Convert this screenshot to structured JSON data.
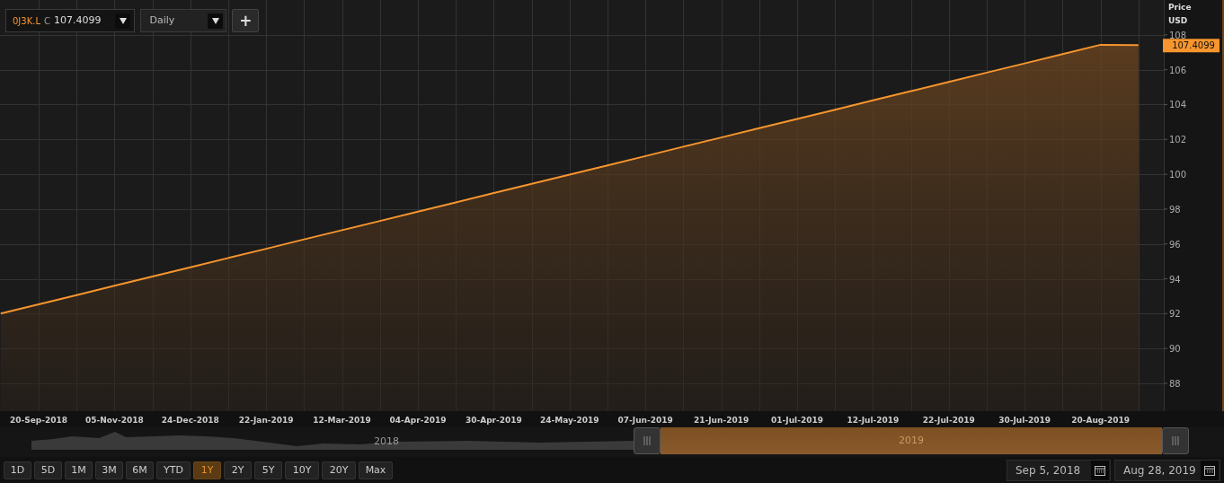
{
  "toolbar": {
    "symbol": "0J3K.L",
    "price_prefix": "C",
    "price": "107.4099",
    "interval": "Daily",
    "add_button": "+"
  },
  "chart": {
    "price_label": "Price",
    "currency": "USD",
    "last_price": "107.4099",
    "chart_data": {
      "type": "area",
      "grid": true,
      "categories": [
        null,
        "20-Sep-2018",
        null,
        "05-Nov-2018",
        null,
        "24-Dec-2018",
        null,
        "22-Jan-2019",
        null,
        "12-Mar-2019",
        null,
        "04-Apr-2019",
        null,
        "30-Apr-2019",
        null,
        "24-May-2019",
        null,
        "07-Jun-2019",
        null,
        "21-Jun-2019",
        null,
        "01-Jul-2019",
        null,
        "12-Jul-2019",
        null,
        "22-Jul-2019",
        null,
        "30-Jul-2019",
        null,
        "20-Aug-2019",
        null
      ],
      "series": [
        {
          "color": "#f7952e",
          "values": [
            92.0,
            92.53,
            93.06,
            93.6,
            94.13,
            94.66,
            95.19,
            95.72,
            96.26,
            96.79,
            97.32,
            97.85,
            98.38,
            98.92,
            99.45,
            99.98,
            100.51,
            101.04,
            101.58,
            102.11,
            102.64,
            103.17,
            103.7,
            104.24,
            104.77,
            105.3,
            105.83,
            106.36,
            106.9,
            107.43,
            107.41
          ]
        }
      ],
      "ylim": [
        86.4,
        110
      ],
      "yticks": [
        88,
        90,
        92,
        94,
        96,
        98,
        100,
        102,
        104,
        106,
        108
      ]
    }
  },
  "navigator": {
    "labels": [
      "2018",
      "2019"
    ]
  },
  "ranges": [
    {
      "label": "1D",
      "selected": false
    },
    {
      "label": "5D",
      "selected": false
    },
    {
      "label": "1M",
      "selected": false
    },
    {
      "label": "3M",
      "selected": false
    },
    {
      "label": "6M",
      "selected": false
    },
    {
      "label": "YTD",
      "selected": false
    },
    {
      "label": "1Y",
      "selected": true
    },
    {
      "label": "2Y",
      "selected": false
    },
    {
      "label": "5Y",
      "selected": false
    },
    {
      "label": "10Y",
      "selected": false
    },
    {
      "label": "20Y",
      "selected": false
    },
    {
      "label": "Max",
      "selected": false
    }
  ],
  "date_range": {
    "from": "Sep 5, 2018",
    "to": "Aug 28, 2019"
  }
}
